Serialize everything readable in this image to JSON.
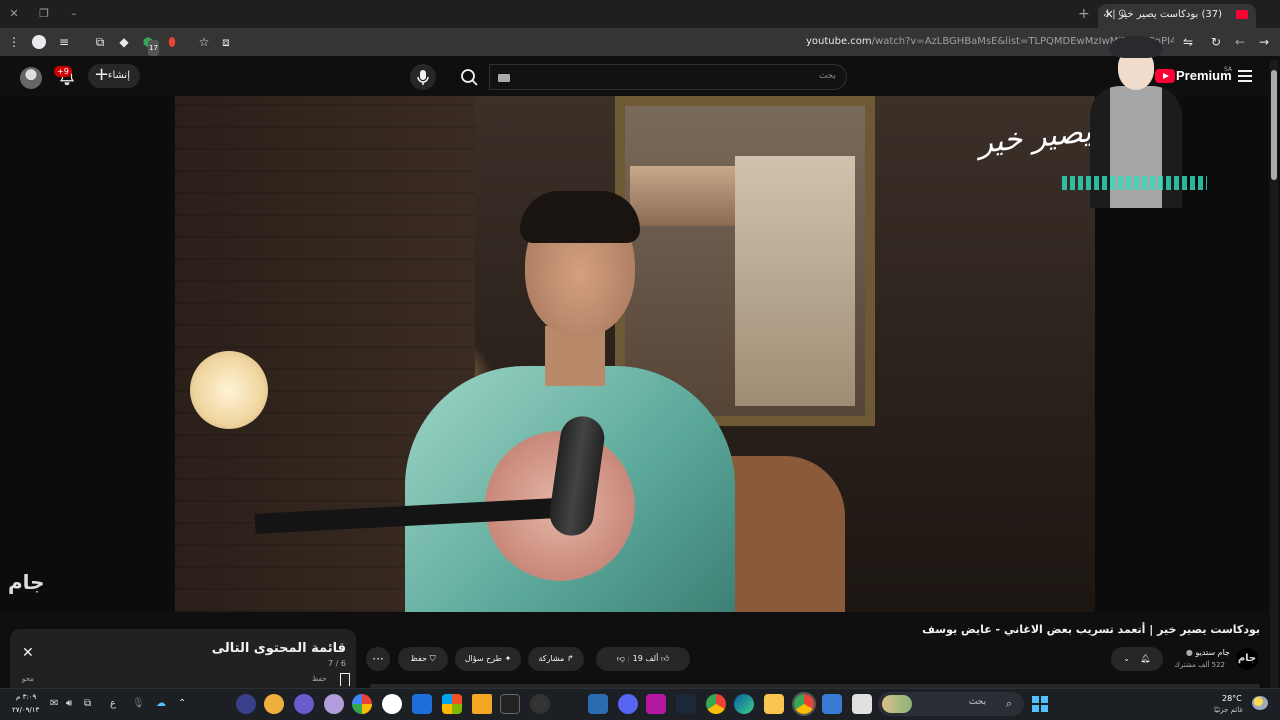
{
  "browser": {
    "tab_title": "(37) بودكاست يصير خير | أت...",
    "tab_mute": "⊙",
    "new_tab": "+",
    "url_host": "youtube.com",
    "url_path": "/watch?v=AzLBGHBaMsE&list=TLPQMDEwMzIwMjZuG08nPI4A...dex=6",
    "extension_badge": "17"
  },
  "masthead": {
    "create_label": "إنشاء",
    "notifications_badge": "+9",
    "search_placeholder": "بحث",
    "logo_text": "Premium",
    "logo_country": "SA"
  },
  "video": {
    "watermark": "يصير خير",
    "channel_watermark": "جام",
    "title": "بودكاست يصير خير | أتعمد تسريب بعض الاغاني - عايض يوسف"
  },
  "channel": {
    "name": "جام ستديو",
    "subscribers": "522 ألف مشترك",
    "avatar_text": "جام"
  },
  "actions": {
    "likes": "19 ألف",
    "share": "مشاركة",
    "ask": "طرح سؤال",
    "save": "حفظ",
    "more": "···"
  },
  "playlist": {
    "title": "قائمة المحتوى التالى",
    "position": "7 / 6",
    "save": "حفظ",
    "other": "محو"
  },
  "taskbar": {
    "search_label": "بحث",
    "weather_temp": "28°C",
    "weather_desc": "غائم جزئيًا",
    "time": "٣:٠٩ م",
    "date": "٢٧/٠٩/١٣",
    "lang": "ع"
  },
  "colors": {
    "accent": "#ff0033",
    "background": "#0f0f0f"
  }
}
